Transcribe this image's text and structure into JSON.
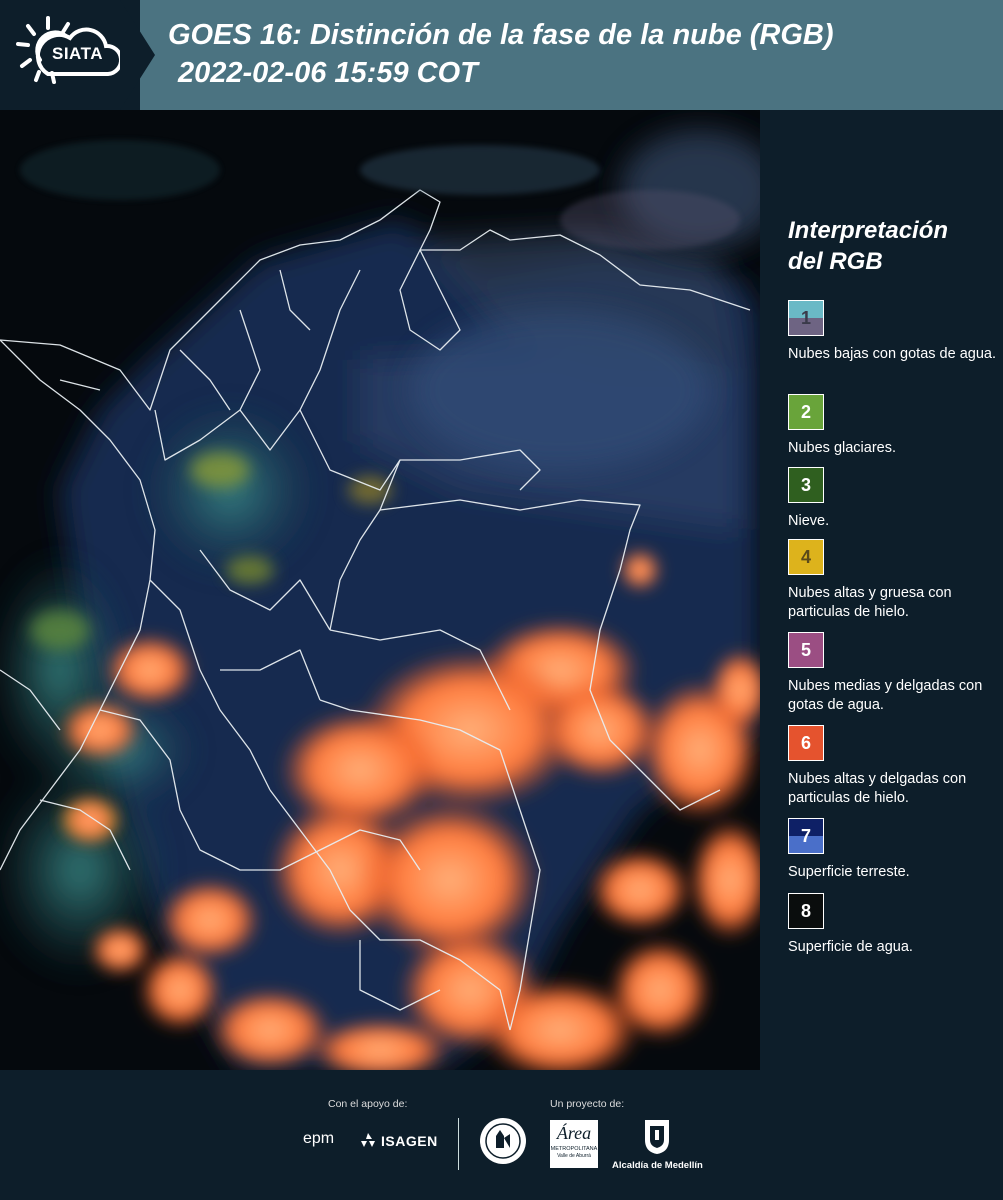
{
  "header": {
    "logo_text": "SIATA",
    "title_line1": "GOES 16: Distinción de la fase de la nube (RGB)",
    "title_line2": "2022-02-06 15:59 COT"
  },
  "legend": {
    "title_line1": "Interpretación",
    "title_line2": "del RGB",
    "items": [
      {
        "num": "1",
        "label": "Nubes bajas con gotas de agua.",
        "color_top": "#6ab9c6",
        "color_bottom": "#6e6483",
        "num_color": "#3a3a4a"
      },
      {
        "num": "2",
        "label": "Nubes glaciares.",
        "color_top": "#69a43a",
        "color_bottom": "#69a43a",
        "num_color": "#ffffff"
      },
      {
        "num": "3",
        "label": "Nieve.",
        "color_top": "#2f5f1f",
        "color_bottom": "#2f5f1f",
        "num_color": "#ffffff"
      },
      {
        "num": "4",
        "label": "Nubes altas y gruesa con particulas de hielo.",
        "color_top": "#ddb31c",
        "color_bottom": "#ddb31c",
        "num_color": "#5a4a1a"
      },
      {
        "num": "5",
        "label": "Nubes medias y delgadas con gotas de agua.",
        "color_top": "#9b4e83",
        "color_bottom": "#9b4e83",
        "num_color": "#ffffff"
      },
      {
        "num": "6",
        "label": "Nubes altas y delgadas con particulas de hielo.",
        "color_top": "#e5532e",
        "color_bottom": "#e5532e",
        "num_color": "#ffffff"
      },
      {
        "num": "7",
        "label": "Superficie terreste.",
        "color_top": "#0e2066",
        "color_bottom": "#4a6fc9",
        "num_color": "#ffffff"
      },
      {
        "num": "8",
        "label": "Superficie de agua.",
        "color_top": "#0a0d0d",
        "color_bottom": "#0a0d0d",
        "num_color": "#ffffff"
      }
    ]
  },
  "footer": {
    "support_label": "Con el apoyo de:",
    "project_label": "Un proyecto de:",
    "sponsor1": "epm",
    "sponsor2": "ISAGEN",
    "partner_area": "Área",
    "partner_area_sub1": "METROPOLITANA",
    "partner_area_sub2": "Valle de Aburrá",
    "partner_alcaldia": "Alcaldía de Medellín"
  }
}
